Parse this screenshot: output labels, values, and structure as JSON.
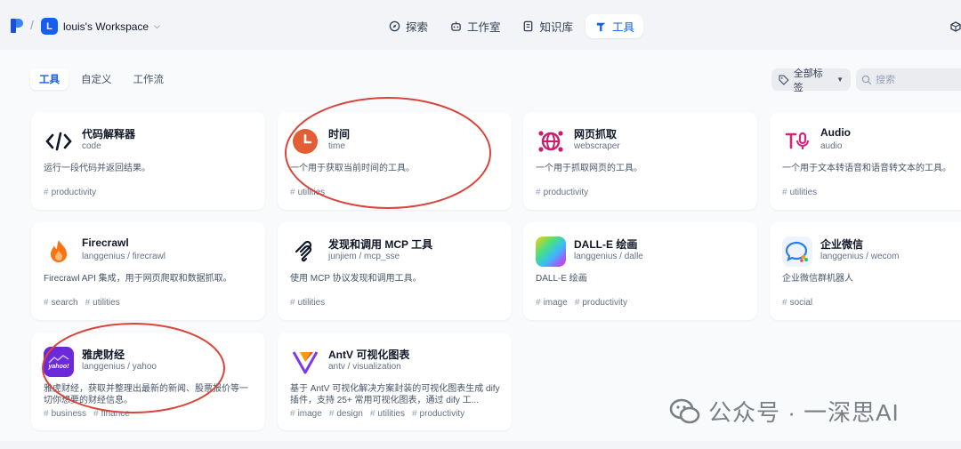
{
  "workspace": {
    "initial": "L",
    "name": "louis's Workspace"
  },
  "nav": [
    {
      "label": "探索",
      "icon": "compass-icon"
    },
    {
      "label": "工作室",
      "icon": "robot-icon"
    },
    {
      "label": "知识库",
      "icon": "book-icon"
    },
    {
      "label": "工具",
      "icon": "tools-icon",
      "active": true
    }
  ],
  "tabs": [
    {
      "label": "工具",
      "active": true
    },
    {
      "label": "自定义"
    },
    {
      "label": "工作流"
    }
  ],
  "filter": {
    "tag_label": "全部标签",
    "search_placeholder": "搜索"
  },
  "tools": [
    {
      "name": "代码解释器",
      "sub": "code",
      "desc": "运行一段代码并返回结果。",
      "tags": [
        "productivity"
      ],
      "icon": "code-icon"
    },
    {
      "name": "时间",
      "sub": "time",
      "desc": "一个用于获取当前时间的工具。",
      "tags": [
        "utilities"
      ],
      "icon": "clock-icon"
    },
    {
      "name": "网页抓取",
      "sub": "webscraper",
      "desc": "一个用于抓取网页的工具。",
      "tags": [
        "productivity"
      ],
      "icon": "globe-icon"
    },
    {
      "name": "Audio",
      "sub": "audio",
      "desc": "一个用于文本转语音和语音转文本的工具。",
      "tags": [
        "utilities"
      ],
      "icon": "audio-icon"
    },
    {
      "name": "Firecrawl",
      "sub_org": "langgenius",
      "sub_repo": "firecrawl",
      "desc": "Firecrawl API 集成，用于网页爬取和数据抓取。",
      "tags": [
        "search",
        "utilities"
      ],
      "icon": "fire-icon"
    },
    {
      "name": "发现和调用 MCP 工具",
      "sub_org": "junjiem",
      "sub_repo": "mcp_sse",
      "desc": "使用 MCP 协议发现和调用工具。",
      "tags": [
        "utilities"
      ],
      "icon": "mcp-icon"
    },
    {
      "name": "DALL-E 绘画",
      "sub_org": "langgenius",
      "sub_repo": "dalle",
      "desc": "DALL-E 绘画",
      "tags": [
        "image",
        "productivity"
      ],
      "icon": "dalle-icon"
    },
    {
      "name": "企业微信",
      "sub_org": "langgenius",
      "sub_repo": "wecom",
      "desc": "企业微信群机器人",
      "tags": [
        "social"
      ],
      "icon": "wecom-icon"
    },
    {
      "name": "雅虎财经",
      "sub_org": "langgenius",
      "sub_repo": "yahoo",
      "desc": "雅虎财经，获取并整理出最新的新闻、股票报价等一切你想要的财经信息。",
      "tags": [
        "business",
        "finance"
      ],
      "icon": "yahoo-icon"
    },
    {
      "name": "AntV 可视化图表",
      "sub_org": "antv",
      "sub_repo": "visualization",
      "desc": "基于 AntV 可视化解决方案封装的可视化图表生成 dify 插件，支持 25+ 常用可视化图表，通过 dify 工...",
      "tags": [
        "image",
        "design",
        "utilities",
        "productivity"
      ],
      "icon": "antv-icon"
    }
  ],
  "icon_text": {
    "yahoo": "yahoo!"
  },
  "watermark": "公众号 · 一深思AI",
  "colors": {
    "accent": "#155eef",
    "annotation": "#d9453a",
    "clock": "#e35d35"
  }
}
